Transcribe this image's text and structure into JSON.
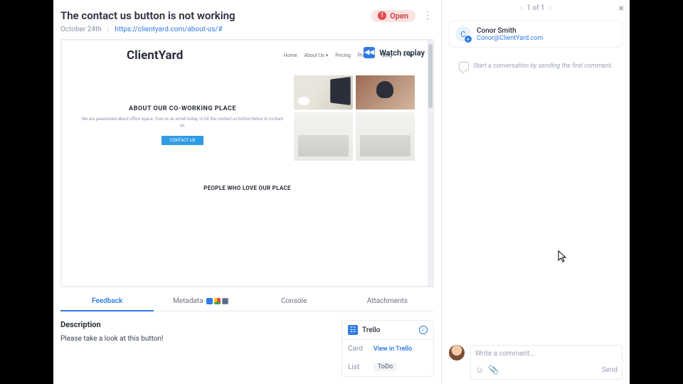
{
  "header": {
    "title": "The contact us button is not working",
    "date": "October 24th",
    "url": "https://clientyard.com/about-us/#",
    "status": "Open",
    "status_icon": "!"
  },
  "replay": {
    "label": "Watch replay"
  },
  "site": {
    "brand": "ClientYard",
    "nav": [
      "Home",
      "About Us ▾",
      "Pricing",
      "Product",
      "Blog"
    ],
    "heading": "ABOUT OUR CO-WORKING PLACE",
    "copy": "We are passionate about office space. Give us an email today, or hit the contact us button below to contact us.",
    "cta": "CONTACT US",
    "footer": "PEOPLE WHO LOVE OUR PLACE"
  },
  "tabs": [
    "Feedback",
    "Metadata",
    "Console",
    "Attachments"
  ],
  "description": {
    "title": "Description",
    "body": "Please take a look at this button!"
  },
  "integration": {
    "name": "Trello",
    "rows": [
      {
        "label": "Card",
        "value": "View in Trello",
        "link": true
      },
      {
        "label": "List",
        "value": "ToDo",
        "chip": true
      }
    ]
  },
  "pager": {
    "label": "1 of 1"
  },
  "user": {
    "initial": "C",
    "name": "Conor Smith",
    "email": "Conor@ClientYard.com"
  },
  "hint": "Start a conversation by sending the first comment.",
  "comment": {
    "placeholder": "Write a comment...",
    "send": "Send"
  }
}
